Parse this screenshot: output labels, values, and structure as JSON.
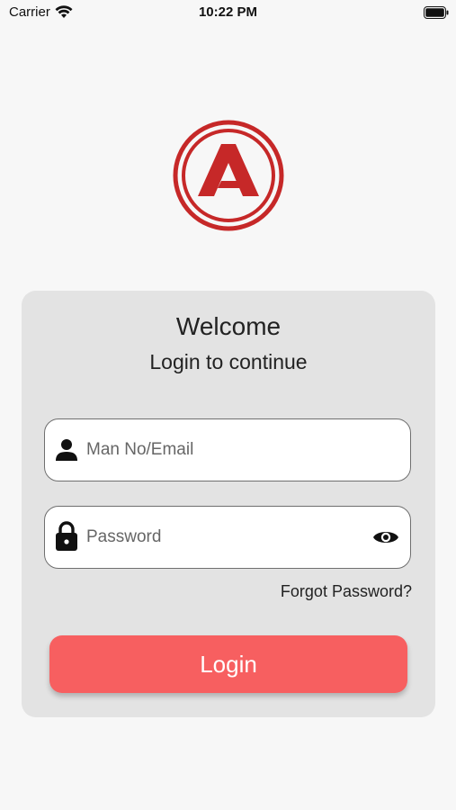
{
  "status_bar": {
    "carrier": "Carrier",
    "time": "10:22 PM",
    "wifi_icon": "wifi-icon",
    "battery_icon": "battery-icon"
  },
  "logo": {
    "icon": "brand-logo",
    "color": "#c62828"
  },
  "card": {
    "title": "Welcome",
    "subtitle": "Login to continue",
    "background": "#e3e3e3"
  },
  "fields": {
    "username": {
      "placeholder": "Man No/Email",
      "value": "",
      "icon": "user-icon"
    },
    "password": {
      "placeholder": "Password",
      "value": "",
      "icon": "lock-icon",
      "toggle_icon": "eye-icon"
    }
  },
  "forgot_password": "Forgot Password?",
  "login_button": {
    "label": "Login",
    "color": "#f75f60"
  }
}
